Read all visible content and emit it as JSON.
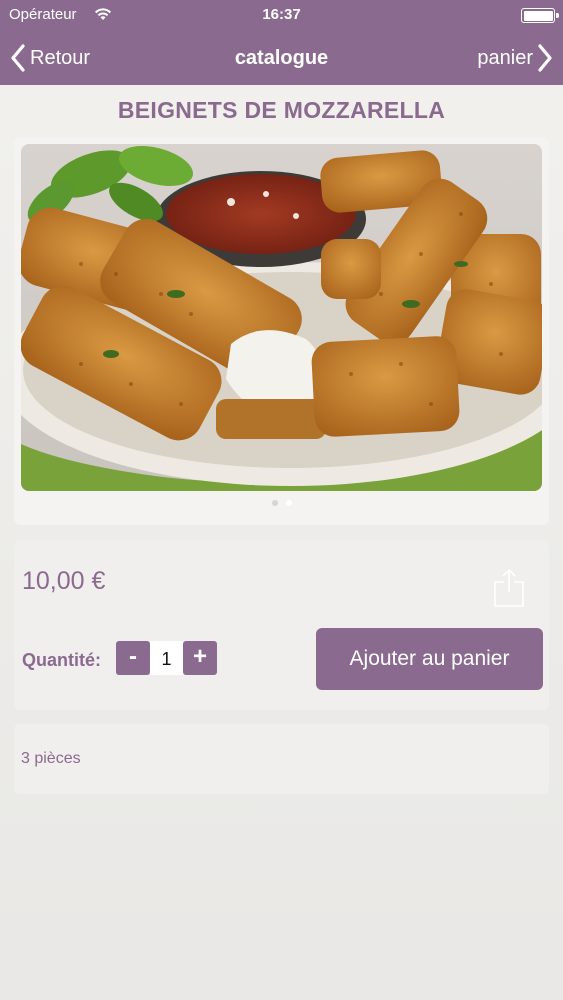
{
  "status_bar": {
    "carrier": "Opérateur",
    "time": "16:37",
    "wifi_icon": "wifi-icon",
    "battery_icon": "battery-icon"
  },
  "nav": {
    "back_label": "Retour",
    "title": "catalogue",
    "cart_label": "panier"
  },
  "product": {
    "title": "BEIGNETS DE MOZZARELLA",
    "image": "mozzarella-sticks-photo",
    "carousel": {
      "count": 2,
      "active_index": 1
    },
    "price": "10,00 €",
    "share_icon": "share-icon",
    "quantity_label": "Quantité:",
    "quantity_minus": "-",
    "quantity_value": "1",
    "quantity_plus": "+",
    "add_to_cart_label": "Ajouter au panier",
    "description": "3 pièces"
  },
  "colors": {
    "brand": "#8b6a8f",
    "background": "#f2f1ee",
    "card": "#f0efed"
  }
}
